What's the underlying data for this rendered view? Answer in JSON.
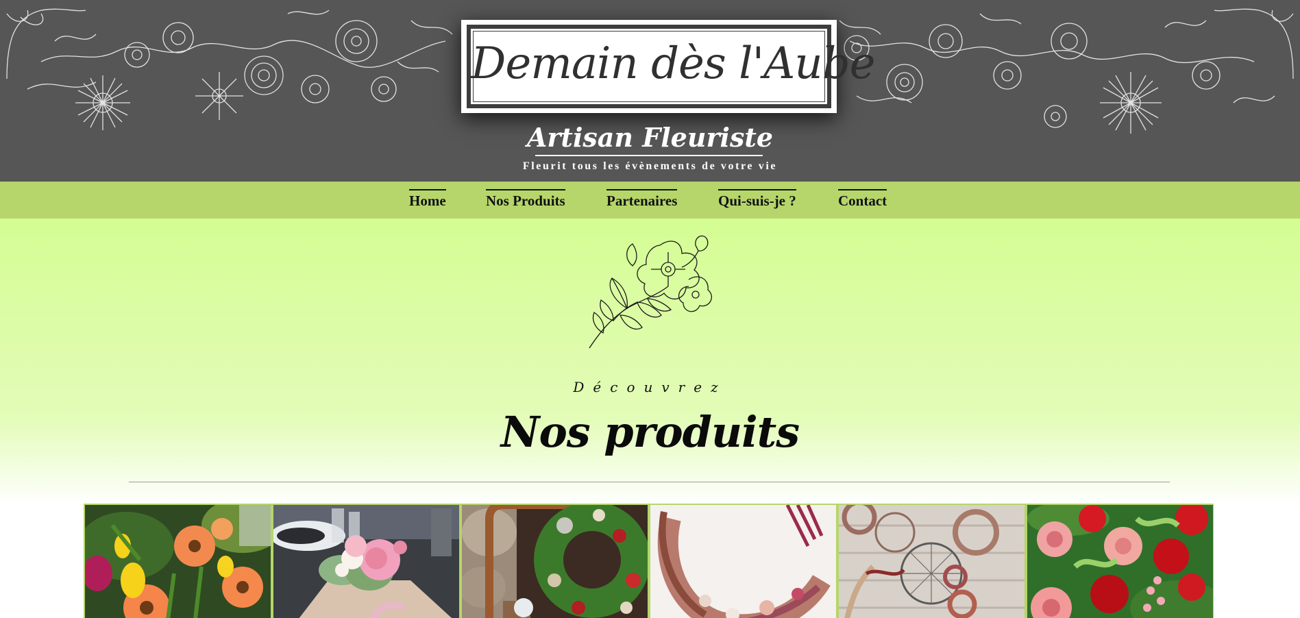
{
  "header": {
    "logo_text": "Demain dès l'Aube",
    "subtitle": "Artisan Fleuriste",
    "tagline": "Fleurit tous les évènements de votre vie"
  },
  "nav": {
    "items": [
      {
        "label": "Home"
      },
      {
        "label": "Nos Produits"
      },
      {
        "label": "Partenaires"
      },
      {
        "label": "Qui-suis-je ?"
      },
      {
        "label": "Contact"
      }
    ]
  },
  "section": {
    "eyebrow": "Découvrez",
    "title": "Nos produits"
  },
  "gallery": {
    "items": [
      {
        "photo": "gerbera-bouquet"
      },
      {
        "photo": "peony-table-centerpiece"
      },
      {
        "photo": "moss-wreath-display"
      },
      {
        "photo": "dried-flower-crescent-wreath"
      },
      {
        "photo": "dried-flower-hoops-wall"
      },
      {
        "photo": "rose-bouquet"
      }
    ]
  },
  "colors": {
    "header_bg": "#565656",
    "nav_bg": "#b6d66b",
    "content_gradient_top": "#d4fd93",
    "gallery_border": "#b6d66b"
  }
}
